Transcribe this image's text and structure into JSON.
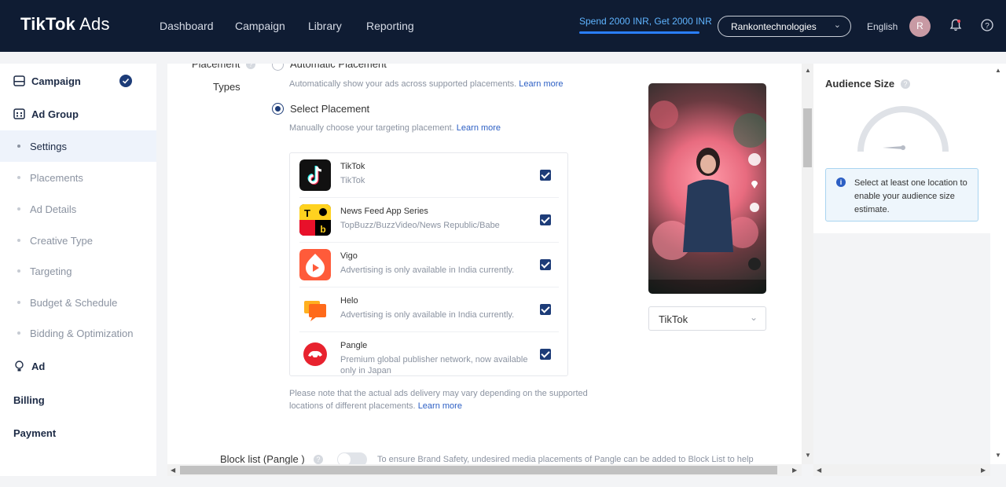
{
  "header": {
    "brand_main": "TikTok",
    "brand_suffix": " Ads",
    "nav": [
      "Dashboard",
      "Campaign",
      "Library",
      "Reporting"
    ],
    "promo": "Spend 2000 INR, Get 2000 INR",
    "account": "Rankontechnologies",
    "language": "English",
    "avatar_initial": "R",
    "colors": {
      "bar": "#0f1c33",
      "promo": "#5fb4ff"
    }
  },
  "sidebar": {
    "campaign": "Campaign",
    "ad_group": "Ad Group",
    "sub_items": [
      "Settings",
      "Placements",
      "Ad Details",
      "Creative Type",
      "Targeting",
      "Budget & Schedule",
      "Bidding & Optimization"
    ],
    "ad": "Ad",
    "billing": "Billing",
    "payment": "Payment"
  },
  "placement": {
    "label_top": "Placement",
    "label_bottom": "Types",
    "auto_label": "Automatic Placement",
    "auto_hint": "Automatically show your ads across supported placements.",
    "select_label": "Select Placement",
    "select_hint": "Manually choose your targeting placement.",
    "learn_more": "Learn more",
    "apps": [
      {
        "name": "TikTok",
        "desc": "TikTok",
        "checked": true,
        "icon": "tiktok-icon"
      },
      {
        "name": "News Feed App Series",
        "desc": "TopBuzz/BuzzVideo/News Republic/Babe",
        "checked": true,
        "icon": "news-feed-icon"
      },
      {
        "name": "Vigo",
        "desc": "Advertising is only available in India currently.",
        "checked": true,
        "icon": "vigo-icon"
      },
      {
        "name": "Helo",
        "desc": "Advertising is only available in India currently.",
        "checked": true,
        "icon": "helo-icon"
      },
      {
        "name": "Pangle",
        "desc": "Premium global publisher network, now available only in Japan",
        "checked": true,
        "icon": "pangle-icon"
      }
    ],
    "note": "Please note that the actual ads delivery may vary depending on the supported locations of different placements.",
    "preview_select": "TikTok"
  },
  "blocklist": {
    "label": "Block list (Pangle )",
    "text": "To ensure Brand Safety, undesired media placements of Pangle can be added to Block List to help"
  },
  "audience": {
    "title": "Audience Size",
    "info": "Select at least one location to enable your audience size estimate."
  }
}
